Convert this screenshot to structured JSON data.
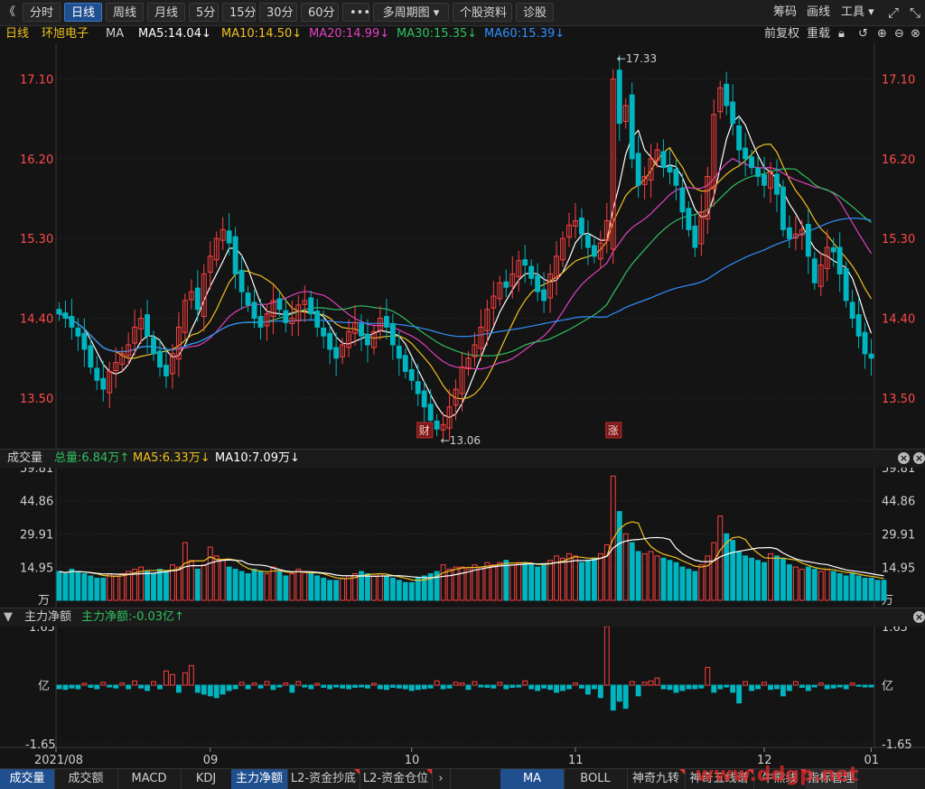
{
  "toolbar": {
    "back_icon": "double-chevron-left-icon",
    "items": [
      {
        "label": "分时",
        "active": false
      },
      {
        "label": "日线",
        "active": true
      },
      {
        "label": "周线",
        "active": false
      },
      {
        "label": "月线",
        "active": false
      },
      {
        "label": "5分",
        "active": false
      },
      {
        "label": "15分",
        "active": false
      },
      {
        "label": "30分",
        "active": false
      },
      {
        "label": "60分",
        "active": false
      },
      {
        "label": "•••",
        "active": false
      },
      {
        "label": "多周期图 ▾",
        "active": false
      },
      {
        "label": "个股资料",
        "active": false
      },
      {
        "label": "诊股",
        "active": false
      }
    ],
    "right": {
      "chouma": "筹码",
      "huaxian": "画线",
      "gongju": "工具 ▾"
    }
  },
  "ma_legend": {
    "period": "日线",
    "stock_name": "环旭电子",
    "indicator": "MA",
    "ma5": "MA5:14.04↓",
    "ma10": "MA10:14.50↓",
    "ma20": "MA20:14.99↓",
    "ma30": "MA30:15.35↓",
    "ma60": "MA60:15.39↓",
    "qianfuquan": "前复权",
    "chongjian": "重载"
  },
  "colors": {
    "up": "#ff4040",
    "down": "#00b5c0",
    "ma5": "#ffffff",
    "ma10": "#f0c020",
    "ma20": "#e040c0",
    "ma30": "#30c060",
    "ma60": "#3090ff",
    "axis_red": "#ff4a4a",
    "background": "#141414"
  },
  "price_chart": {
    "y_ticks": [
      "17.10",
      "16.20",
      "15.30",
      "14.40",
      "13.50"
    ],
    "high_label": "←17.33",
    "low_label": "←13.06",
    "event_markers": [
      "财",
      "涨"
    ]
  },
  "volume_panel": {
    "title": "成交量",
    "total": "总量:6.84万↑",
    "ma5": "MA5:6.33万↓",
    "ma10": "MA10:7.09万↓",
    "y_ticks": [
      "59.81",
      "44.86",
      "29.91",
      "14.95"
    ],
    "unit": "万"
  },
  "flow_panel": {
    "title": "主力净额",
    "value": "主力净额:-0.03亿↑",
    "y_ticks": [
      "1.65",
      "亿",
      "-1.65"
    ]
  },
  "x_axis": {
    "labels": [
      "2021/08",
      "09",
      "10",
      "11",
      "12",
      "01"
    ]
  },
  "bottom_tabs": {
    "left": [
      "成交量",
      "成交额",
      "MACD",
      "KDJ",
      "主力净额",
      "L2-资金抄底",
      "L2-资金仓位"
    ],
    "right": [
      "MA",
      "BOLL",
      "神奇九转",
      "神奇五线谱",
      "牛熊线",
      "指标管理"
    ],
    "watermark": "www.ddgp.net"
  },
  "chart_data": {
    "type": "candlestick",
    "x_labels": [
      "2021/08",
      "09",
      "10",
      "11",
      "12",
      "01"
    ],
    "price_ylim": [
      13.0,
      17.4
    ],
    "closes": [
      14.45,
      14.4,
      14.3,
      14.2,
      14.05,
      13.85,
      13.7,
      13.6,
      13.8,
      13.9,
      14.0,
      14.1,
      14.3,
      14.4,
      14.2,
      14.0,
      13.85,
      13.75,
      14.0,
      14.3,
      14.6,
      14.7,
      14.5,
      14.9,
      15.1,
      15.3,
      15.4,
      15.25,
      14.9,
      14.7,
      14.55,
      14.4,
      14.3,
      14.45,
      14.6,
      14.5,
      14.35,
      14.4,
      14.55,
      14.6,
      14.45,
      14.3,
      14.2,
      14.05,
      13.95,
      14.1,
      14.25,
      14.35,
      14.2,
      14.1,
      14.25,
      14.4,
      14.3,
      14.1,
      13.95,
      13.8,
      13.7,
      13.55,
      13.4,
      13.25,
      13.15,
      13.2,
      13.4,
      13.6,
      13.85,
      13.95,
      14.1,
      14.3,
      14.5,
      14.65,
      14.8,
      14.75,
      14.9,
      15.05,
      15.0,
      14.85,
      14.7,
      14.6,
      14.9,
      15.1,
      15.3,
      15.45,
      15.5,
      15.35,
      15.2,
      15.1,
      15.25,
      15.5,
      17.1,
      16.6,
      16.8,
      16.2,
      15.9,
      16.0,
      16.2,
      16.3,
      16.1,
      16.05,
      15.9,
      15.6,
      15.4,
      15.2,
      15.6,
      16.0,
      16.7,
      17.0,
      16.8,
      16.6,
      16.3,
      16.2,
      16.1,
      16.0,
      15.9,
      16.05,
      15.8,
      15.4,
      15.3,
      15.35,
      15.4,
      15.1,
      14.8,
      15.0,
      15.2,
      15.15,
      14.9,
      14.6,
      14.4,
      14.2,
      14.0,
      13.95
    ],
    "high_low_marks": {
      "high": 17.33,
      "low": 13.06
    },
    "ma_last": {
      "MA5": 14.04,
      "MA10": 14.5,
      "MA20": 14.99,
      "MA30": 15.35,
      "MA60": 15.39
    },
    "volume_ylim": [
      0,
      59.81
    ],
    "volumes": [
      13,
      12,
      14,
      13,
      12,
      11,
      10,
      10,
      12,
      11,
      12,
      13,
      14,
      15,
      13,
      12,
      14,
      13,
      16,
      15,
      26,
      18,
      14,
      16,
      24,
      20,
      18,
      15,
      14,
      13,
      12,
      14,
      13,
      12,
      15,
      13,
      11,
      12,
      14,
      13,
      12,
      11,
      10,
      9,
      9,
      10,
      11,
      12,
      13,
      12,
      11,
      12,
      11,
      10,
      9,
      8,
      8,
      10,
      11,
      12,
      13,
      16,
      14,
      15,
      15,
      14,
      16,
      15,
      17,
      16,
      17,
      18,
      16,
      17,
      17,
      16,
      15,
      16,
      18,
      20,
      19,
      21,
      20,
      17,
      18,
      19,
      21,
      25,
      56,
      40,
      30,
      26,
      22,
      21,
      22,
      20,
      19,
      18,
      17,
      15,
      14,
      13,
      16,
      20,
      26,
      38,
      30,
      27,
      22,
      20,
      19,
      18,
      17,
      21,
      20,
      19,
      16,
      15,
      14,
      15,
      14,
      13,
      14,
      13,
      12,
      11,
      12,
      11,
      10,
      10,
      9,
      9
    ],
    "flow_ylim": [
      -1.65,
      1.65
    ],
    "flow": [
      -0.1,
      -0.12,
      -0.08,
      -0.1,
      0.05,
      -0.06,
      -0.1,
      0.08,
      -0.05,
      -0.08,
      0.06,
      -0.1,
      0.12,
      -0.08,
      -0.15,
      0.1,
      -0.1,
      0.4,
      0.3,
      -0.2,
      0.35,
      0.55,
      -0.2,
      -0.25,
      -0.3,
      -0.35,
      -0.25,
      -0.15,
      -0.1,
      0.08,
      -0.1,
      0.06,
      -0.08,
      0.1,
      -0.12,
      -0.05,
      0.06,
      -0.2,
      0.1,
      -0.05,
      -0.1,
      0.05,
      -0.06,
      -0.1,
      -0.05,
      -0.08,
      -0.1,
      -0.06,
      -0.05,
      -0.08,
      0.05,
      -0.1,
      -0.12,
      -0.06,
      -0.08,
      -0.1,
      -0.15,
      -0.12,
      -0.1,
      -0.08,
      0.12,
      -0.1,
      -0.08,
      0.08,
      0.06,
      -0.12,
      0.1,
      -0.05,
      -0.06,
      -0.08,
      0.08,
      -0.1,
      -0.06,
      -0.05,
      0.12,
      -0.1,
      -0.15,
      -0.08,
      -0.12,
      -0.2,
      -0.15,
      -0.1,
      0.06,
      -0.08,
      -0.25,
      -0.1,
      -0.35,
      1.65,
      -0.7,
      -0.45,
      -0.65,
      0.1,
      -0.3,
      0.08,
      0.12,
      0.2,
      -0.1,
      -0.12,
      -0.2,
      -0.15,
      -0.1,
      -0.1,
      -0.08,
      0.5,
      -0.2,
      -0.1,
      -0.05,
      -0.2,
      -0.5,
      0.1,
      -0.15,
      -0.1,
      0.08,
      -0.12,
      -0.1,
      -0.3,
      -0.15,
      0.1,
      -0.06,
      -0.15,
      -0.05,
      0.06,
      -0.1,
      -0.08,
      -0.05,
      -0.1,
      0.06,
      -0.03,
      -0.05,
      -0.05
    ]
  }
}
